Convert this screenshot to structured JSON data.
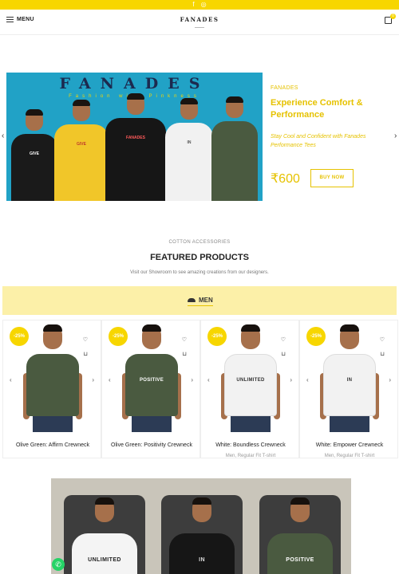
{
  "topbar": {
    "icons": [
      "facebook-icon",
      "instagram-icon"
    ],
    "glyph_facebook": "f",
    "glyph_instagram": "◎"
  },
  "header": {
    "menu_label": "MENU",
    "logo": "FANADES",
    "cart_count": "0"
  },
  "hero": {
    "brand": "FANADES",
    "tagline": "Fashion with Pinkness",
    "kicker": "FANADES",
    "title": "Experience Comfort & Performance",
    "description": "Stay Cool and Confident with Fanades Performance Tees",
    "price": "₹600",
    "cta": "BUY NOW",
    "prev_arrow": "‹",
    "next_arrow": "›",
    "shirt_prints": [
      "GIVE",
      "GIVE",
      "FANADES",
      "IN",
      ""
    ]
  },
  "featured": {
    "kicker": "COTTON ACCESSORIES",
    "title": "FEATURED PRODUCTS",
    "subtitle": "Visit our Showroom to see amazing creations from our designers.",
    "tab": "MEN"
  },
  "products": [
    {
      "discount": "-25%",
      "name": "Olive Green: Affirm Crewneck",
      "category": "",
      "print": "",
      "color": "#4a5a40"
    },
    {
      "discount": "-25%",
      "name": "Olive Green: Positivity Crewneck",
      "category": "",
      "print": "POSITIVE",
      "color": "#4a5a40"
    },
    {
      "discount": "-25%",
      "name": "White: Boundless Crewneck",
      "category": "Men, Regular Fit T-shirt",
      "print": "UNLIMITED",
      "color": "#f2f2f2"
    },
    {
      "discount": "-25%",
      "name": "White: Empower Crewneck",
      "category": "Men, Regular Fit T-shirt",
      "print": "IN",
      "color": "#f2f2f2"
    }
  ],
  "card_controls": {
    "wishlist": "♡",
    "cart": "🛒",
    "prev": "‹",
    "next": "›"
  },
  "lookbook": [
    {
      "print": "UNLIMITED",
      "shirt": "#f4f4f4",
      "ink": "#222"
    },
    {
      "print": "IN",
      "shirt": "#161616",
      "ink": "#ddd"
    },
    {
      "print": "POSITIVE",
      "shirt": "#4a5a40",
      "ink": "#fff"
    }
  ],
  "whatsapp_glyph": "✆",
  "colors": {
    "accent": "#f7d600",
    "accent_text": "#e6c200",
    "tab_bg": "#fcf0a8",
    "hero_bg": "#21a2c6"
  }
}
